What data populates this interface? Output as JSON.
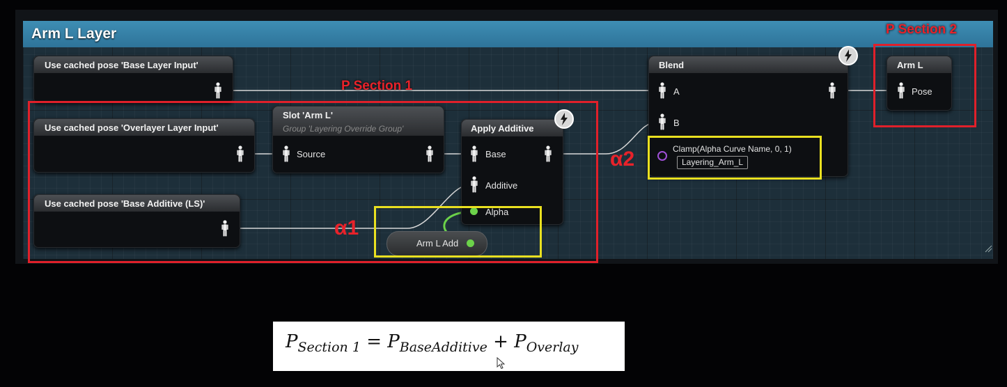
{
  "graph": {
    "title": "Arm L Layer",
    "nodes": {
      "cached_base_layer": "Use cached pose 'Base Layer Input'",
      "cached_overlayer": "Use cached pose 'Overlayer Layer Input'",
      "cached_base_additive": "Use cached pose 'Base Additive (LS)'",
      "slot": {
        "title": "Slot 'Arm L'",
        "group": "Group 'Layering Override Group'",
        "pin_source": "Source"
      },
      "apply_additive": {
        "title": "Apply Additive",
        "pin_base": "Base",
        "pin_additive": "Additive",
        "pin_alpha": "Alpha"
      },
      "arm_l_add": "Arm L Add",
      "blend": {
        "title": "Blend",
        "pin_a": "A",
        "pin_b": "B",
        "clamp_text": "Clamp(Alpha Curve Name, 0, 1)",
        "curve_name": "Layering_Arm_L"
      },
      "output": {
        "title": "Arm L",
        "pin_pose": "Pose"
      }
    }
  },
  "annotations": {
    "section1": "P Section 1",
    "section2": "P Section 2",
    "alpha1": "α1",
    "alpha2": "α2",
    "colors": {
      "red": "#e0202a",
      "yellow": "#e9e020"
    }
  },
  "formula": {
    "lhs_symbol": "P",
    "lhs_sub": "Section 1",
    "equals": "=",
    "term1_symbol": "P",
    "term1_sub": "BaseAdditive",
    "plus": "+",
    "term2_symbol": "P",
    "term2_sub": "Overlay"
  }
}
